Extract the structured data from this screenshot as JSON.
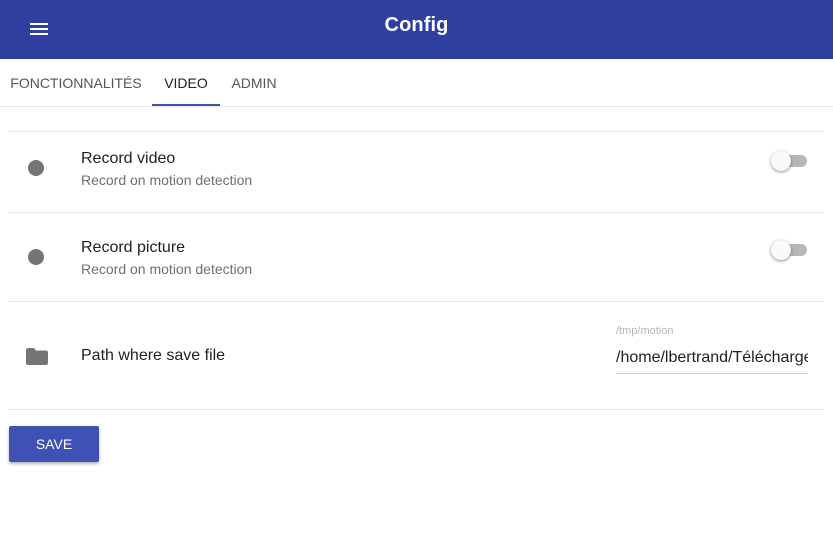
{
  "appbar": {
    "title": "Config",
    "menu_icon": "hamburger-menu-icon",
    "background": "#303f9f"
  },
  "tabs": [
    {
      "label": "FONCTIONNALITÉS",
      "active": false
    },
    {
      "label": "VIDEO",
      "active": true
    },
    {
      "label": "ADMIN",
      "active": false
    }
  ],
  "settings": {
    "record_video": {
      "title": "Record video",
      "subtitle": "Record on motion detection",
      "icon": "dot-icon",
      "enabled": false
    },
    "record_picture": {
      "title": "Record picture",
      "subtitle": "Record on motion detection",
      "icon": "dot-icon",
      "enabled": false
    },
    "save_path": {
      "label": "Path where save file",
      "icon": "folder-icon",
      "hint": "/tmp/motion",
      "value": "/home/lbertrand/Téléchargements"
    }
  },
  "actions": {
    "save_label": "SAVE",
    "accent": "#3f51b5"
  }
}
